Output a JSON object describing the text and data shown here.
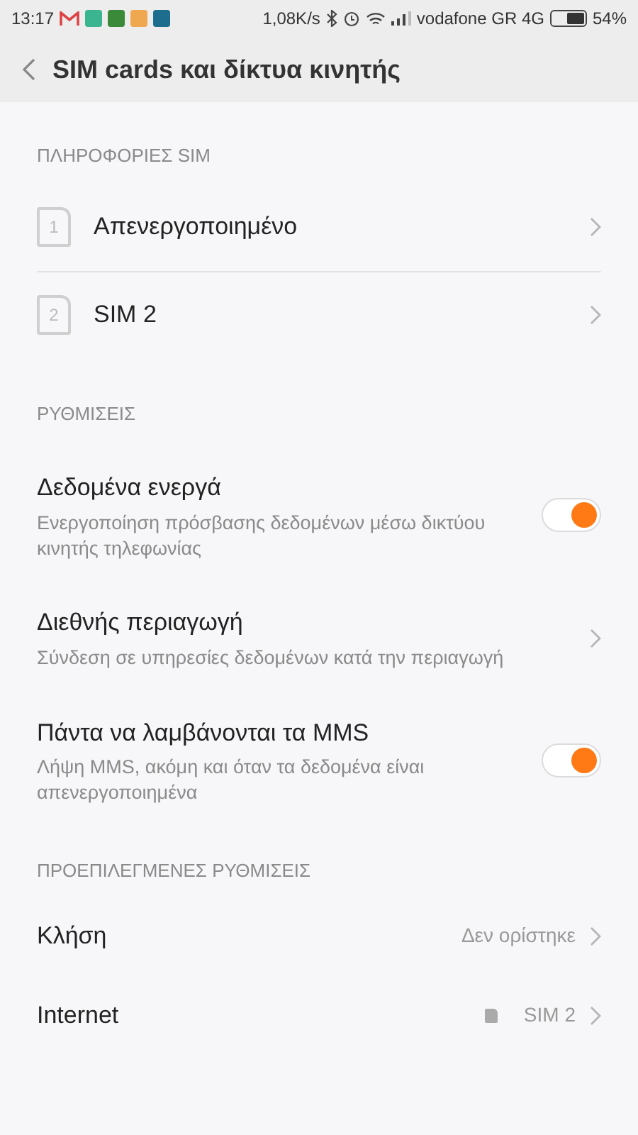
{
  "status_bar": {
    "time": "13:17",
    "speed": "1,08K/s",
    "carrier": "vodafone GR 4G",
    "battery": "54%"
  },
  "header": {
    "title": "SIM cards και δίκτυα κινητής"
  },
  "sim_section": {
    "title": "ΠΛΗΡΟΦΟΡΙΕΣ SIM",
    "items": [
      {
        "number": "1",
        "label": "Απενεργοποιημένο"
      },
      {
        "number": "2",
        "label": "SIM 2"
      }
    ]
  },
  "settings_section": {
    "title": "ΡΥΘΜΙΣΕΙΣ",
    "items": [
      {
        "kind": "toggle",
        "title": "Δεδομένα ενεργά",
        "subtitle": "Ενεργοποίηση πρόσβασης δεδομένων μέσω δικτύου κινητής τηλεφωνίας",
        "on": true
      },
      {
        "kind": "link",
        "title": "Διεθνής περιαγωγή",
        "subtitle": "Σύνδεση σε υπηρεσίες δεδομένων κατά την περιαγωγή"
      },
      {
        "kind": "toggle",
        "title": "Πάντα να λαμβάνονται τα MMS",
        "subtitle": "Λήψη MMS, ακόμη και όταν τα δεδομένα είναι απενεργοποιημένα",
        "on": true
      }
    ]
  },
  "defaults_section": {
    "title": "ΠΡΟΕΠΙΛΕΓΜΕΝΕΣ ΡΥΘΜΙΣΕΙΣ",
    "items": [
      {
        "label": "Κλήση",
        "value": "Δεν ορίστηκε"
      },
      {
        "label": "Internet",
        "value": "SIM 2",
        "sim_badge": true
      }
    ]
  }
}
